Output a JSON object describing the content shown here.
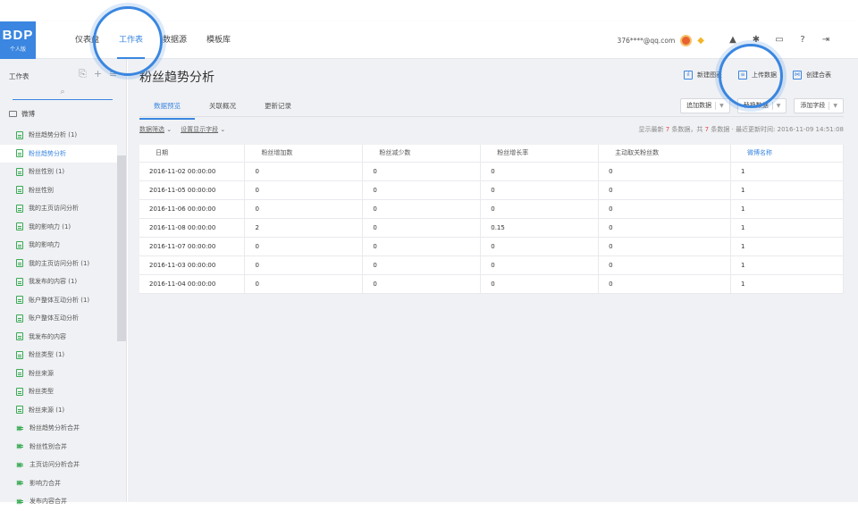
{
  "logo": {
    "text": "BDP",
    "sub": "个人版"
  },
  "nav": {
    "tabs": [
      "仪表盘",
      "工作表",
      "数据源",
      "模板库"
    ],
    "active": 1
  },
  "user": {
    "email": "376****@qq.com"
  },
  "icons": {
    "right": [
      "bell-icon",
      "gear-icon",
      "screen-icon",
      "help-icon",
      "logout-icon"
    ],
    "gem": "diamond-icon"
  },
  "sidebar": {
    "title": "工作表",
    "folder": "微博",
    "items": [
      {
        "label": "粉丝趋势分析 (1)",
        "type": "sheet"
      },
      {
        "label": "粉丝趋势分析",
        "type": "sheet",
        "active": true
      },
      {
        "label": "粉丝性别 (1)",
        "type": "sheet"
      },
      {
        "label": "粉丝性别",
        "type": "sheet"
      },
      {
        "label": "我的主页访问分析",
        "type": "sheet"
      },
      {
        "label": "我的影响力 (1)",
        "type": "sheet"
      },
      {
        "label": "我的影响力",
        "type": "sheet"
      },
      {
        "label": "我的主页访问分析 (1)",
        "type": "sheet"
      },
      {
        "label": "我发布的内容 (1)",
        "type": "sheet"
      },
      {
        "label": "账户整体互动分析 (1)",
        "type": "sheet"
      },
      {
        "label": "账户整体互动分析",
        "type": "sheet"
      },
      {
        "label": "我发布的内容",
        "type": "sheet"
      },
      {
        "label": "粉丝类型 (1)",
        "type": "sheet"
      },
      {
        "label": "粉丝来源",
        "type": "sheet"
      },
      {
        "label": "粉丝类型",
        "type": "sheet"
      },
      {
        "label": "粉丝来源 (1)",
        "type": "sheet"
      },
      {
        "label": "粉丝趋势分析合并",
        "type": "merge"
      },
      {
        "label": "粉丝性别合并",
        "type": "merge"
      },
      {
        "label": "主页访问分析合并",
        "type": "merge"
      },
      {
        "label": "影响力合并",
        "type": "merge"
      },
      {
        "label": "发布内容合并",
        "type": "merge"
      }
    ]
  },
  "page": {
    "title": "粉丝趋势分析",
    "actions": [
      "新建图表",
      "上传数据",
      "创建合表"
    ],
    "subtabs": [
      "数据预览",
      "关联概况",
      "更新记录"
    ],
    "dropdowns": [
      "追加数据",
      "替换数据",
      "添加字段"
    ],
    "filters": [
      "数据筛选",
      "设置显示字段"
    ],
    "stat": {
      "prefix": "显示最新",
      "shown": "7",
      "mid": "条数据，共",
      "total": "7",
      "suffix": "条数据",
      "updated": "最近更新时间: 2016-11-09 14:51:08"
    }
  },
  "table": {
    "columns": [
      "日期",
      "粉丝增加数",
      "粉丝减少数",
      "粉丝增长率",
      "主动取关粉丝数",
      "微博名称"
    ],
    "rows": [
      [
        "2016-11-02 00:00:00",
        "0",
        "0",
        "0",
        "0",
        "1"
      ],
      [
        "2016-11-05 00:00:00",
        "0",
        "0",
        "0",
        "0",
        "1"
      ],
      [
        "2016-11-06 00:00:00",
        "0",
        "0",
        "0",
        "0",
        "1"
      ],
      [
        "2016-11-08 00:00:00",
        "2",
        "0",
        "0.15",
        "0",
        "1"
      ],
      [
        "2016-11-07 00:00:00",
        "0",
        "0",
        "0",
        "0",
        "1"
      ],
      [
        "2016-11-03 00:00:00",
        "0",
        "0",
        "0",
        "0",
        "1"
      ],
      [
        "2016-11-04 00:00:00",
        "0",
        "0",
        "0",
        "0",
        "1"
      ]
    ]
  }
}
